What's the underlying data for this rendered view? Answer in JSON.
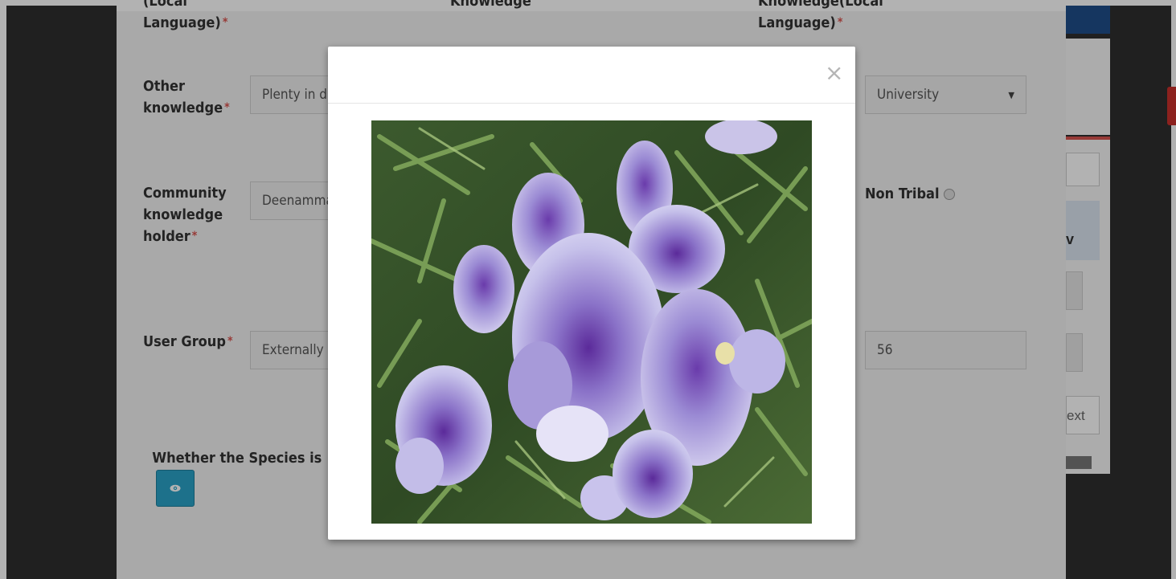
{
  "form": {
    "local_language_label_top": "(Local",
    "local_language_label": "Language)",
    "knowledge_label_top": "Knowledge",
    "knowledge_local_label_top": "Knowledge(Local",
    "knowledge_local_label": "Language)",
    "other_knowledge_label_1": "Other",
    "other_knowledge_label_2": "knowledge",
    "other_knowledge_value": "Plenty in d",
    "source_select_value": "University",
    "community_label_1": "Community",
    "community_label_2": "knowledge",
    "community_label_3": "holder",
    "community_value": "Deenamma",
    "non_tribal_label": "Non Tribal",
    "user_group_label": "User Group",
    "user_group_value": "Externally",
    "count_value": "56",
    "species_question": "Whether the Species is  Ec",
    "required_mark": "*"
  },
  "right_panel": {
    "bold_fragment": "v",
    "next_label": "ext"
  },
  "modal": {
    "close_symbol": "×",
    "image_subject": "purple-flower-photo"
  },
  "colors": {
    "required": "#d9534f",
    "button": "#2aa3c7",
    "overlay": "rgba(0,0,0,0.30)"
  }
}
